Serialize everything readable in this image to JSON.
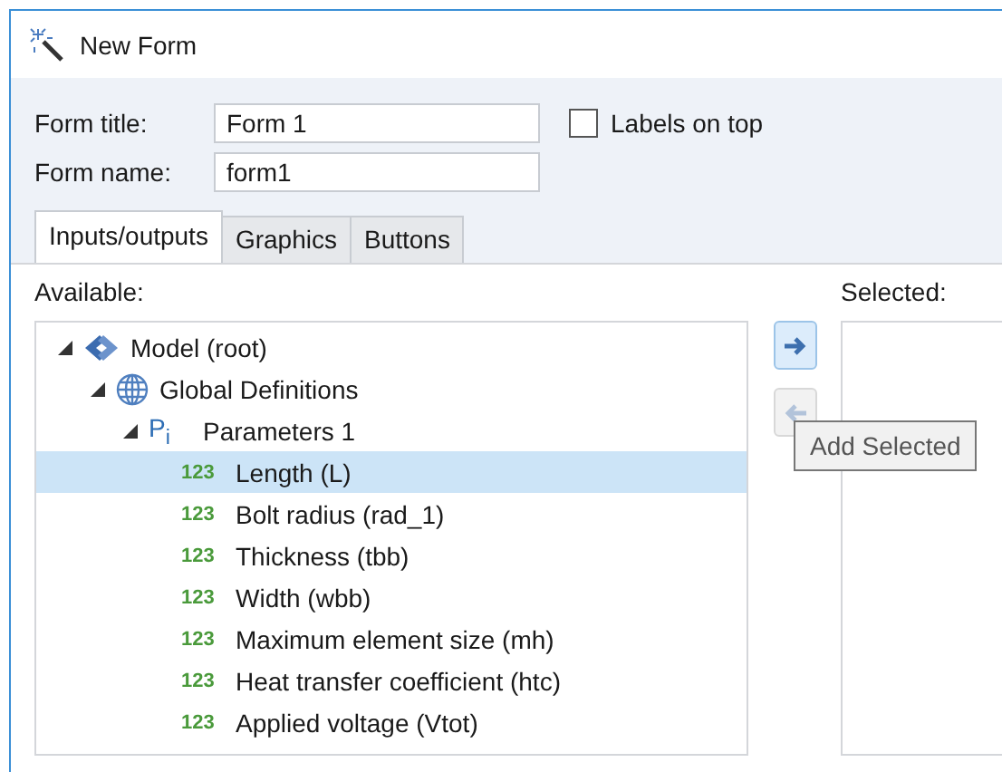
{
  "window": {
    "title": "New Form"
  },
  "form": {
    "title_label": "Form title:",
    "title_value": "Form 1",
    "name_label": "Form name:",
    "name_value": "form1",
    "labels_on_top": {
      "label": "Labels on top",
      "checked": false
    }
  },
  "tabs": [
    {
      "label": "Inputs/outputs",
      "selected": true
    },
    {
      "label": "Graphics",
      "selected": false
    },
    {
      "label": "Buttons",
      "selected": false
    }
  ],
  "available": {
    "label": "Available:",
    "tree": [
      {
        "label": "Model (root)",
        "kind": "model",
        "expanded": true,
        "selected": false,
        "children": [
          {
            "label": "Global Definitions",
            "kind": "globe",
            "expanded": true,
            "selected": false,
            "children": [
              {
                "label": "Parameters 1",
                "kind": "parameters",
                "icon_text": "P$_{i}$",
                "expanded": true,
                "selected": false,
                "children": [
                  {
                    "label": "Length (L)",
                    "kind": "parameter",
                    "icon_text": "123",
                    "selected": true
                  },
                  {
                    "label": "Bolt radius (rad_1)",
                    "kind": "parameter",
                    "icon_text": "123",
                    "selected": false
                  },
                  {
                    "label": "Thickness (tbb)",
                    "kind": "parameter",
                    "icon_text": "123",
                    "selected": false
                  },
                  {
                    "label": "Width (wbb)",
                    "kind": "parameter",
                    "icon_text": "123",
                    "selected": false
                  },
                  {
                    "label": "Maximum element size (mh)",
                    "kind": "parameter",
                    "icon_text": "123",
                    "selected": false
                  },
                  {
                    "label": "Heat transfer coefficient (htc)",
                    "kind": "parameter",
                    "icon_text": "123",
                    "selected": false
                  },
                  {
                    "label": "Applied voltage (Vtot)",
                    "kind": "parameter",
                    "icon_text": "123",
                    "selected": false
                  }
                ]
              }
            ]
          }
        ]
      }
    ]
  },
  "transfer_buttons": [
    {
      "kind": "add",
      "disabled": false
    },
    {
      "kind": "remove",
      "disabled": true
    }
  ],
  "tooltip": {
    "text": "Add Selected"
  },
  "selected": {
    "label": "Selected:"
  }
}
